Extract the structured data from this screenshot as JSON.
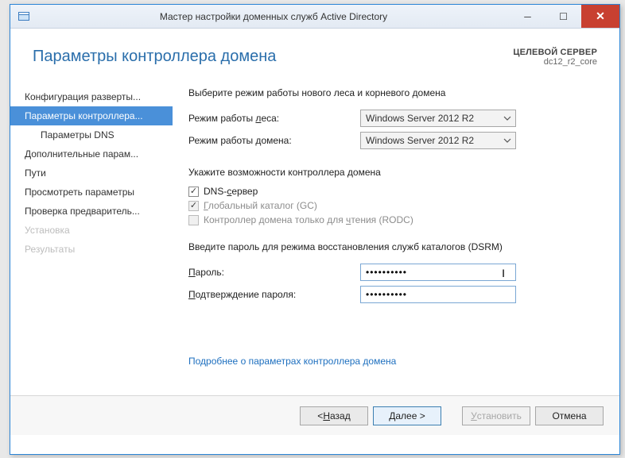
{
  "window": {
    "title": "Мастер настройки доменных служб Active Directory"
  },
  "header": {
    "page_title": "Параметры контроллера домена",
    "target_label": "ЦЕЛЕВОЙ СЕРВЕР",
    "target_value": "dc12_r2_core"
  },
  "sidebar": {
    "items": [
      {
        "label": "Конфигурация разверты...",
        "type": "normal"
      },
      {
        "label": "Параметры контроллера...",
        "type": "active"
      },
      {
        "label": "Параметры DNS",
        "type": "sub"
      },
      {
        "label": "Дополнительные парам...",
        "type": "normal"
      },
      {
        "label": "Пути",
        "type": "normal"
      },
      {
        "label": "Просмотреть параметры",
        "type": "normal"
      },
      {
        "label": "Проверка предваритель...",
        "type": "normal"
      },
      {
        "label": "Установка",
        "type": "disabled"
      },
      {
        "label": "Результаты",
        "type": "disabled"
      }
    ]
  },
  "main": {
    "select_mode_text": "Выберите режим работы нового леса и корневого домена",
    "forest_label": "Режим работы леса:",
    "forest_value": "Windows Server 2012 R2",
    "domain_label": "Режим работы домена:",
    "domain_value": "Windows Server 2012 R2",
    "capabilities_title": "Укажите возможности контроллера домена",
    "chk_dns": "DNS-сервер",
    "chk_gc": "Глобальный каталог (GC)",
    "chk_rodc": "Контроллер домена только для чтения (RODC)",
    "dsrm_text": "Введите пароль для режима восстановления служб каталогов (DSRM)",
    "password_label": "Пароль:",
    "password_value": "••••••••••",
    "confirm_label": "Подтверждение пароля:",
    "confirm_value": "••••••••••",
    "link_text": "Подробнее о параметрах контроллера домена"
  },
  "footer": {
    "back": "< Назад",
    "next": "Далее >",
    "install": "Установить",
    "cancel": "Отмена"
  },
  "underline": {
    "dns_c": "с",
    "gc_g": "Г",
    "rodc_ch": "ч",
    "forest_l": "л",
    "domain_d": "д",
    "pw_p": "П",
    "conf_p": "П",
    "back_n": "Н",
    "next_d": "Д",
    "install_u": "У"
  }
}
